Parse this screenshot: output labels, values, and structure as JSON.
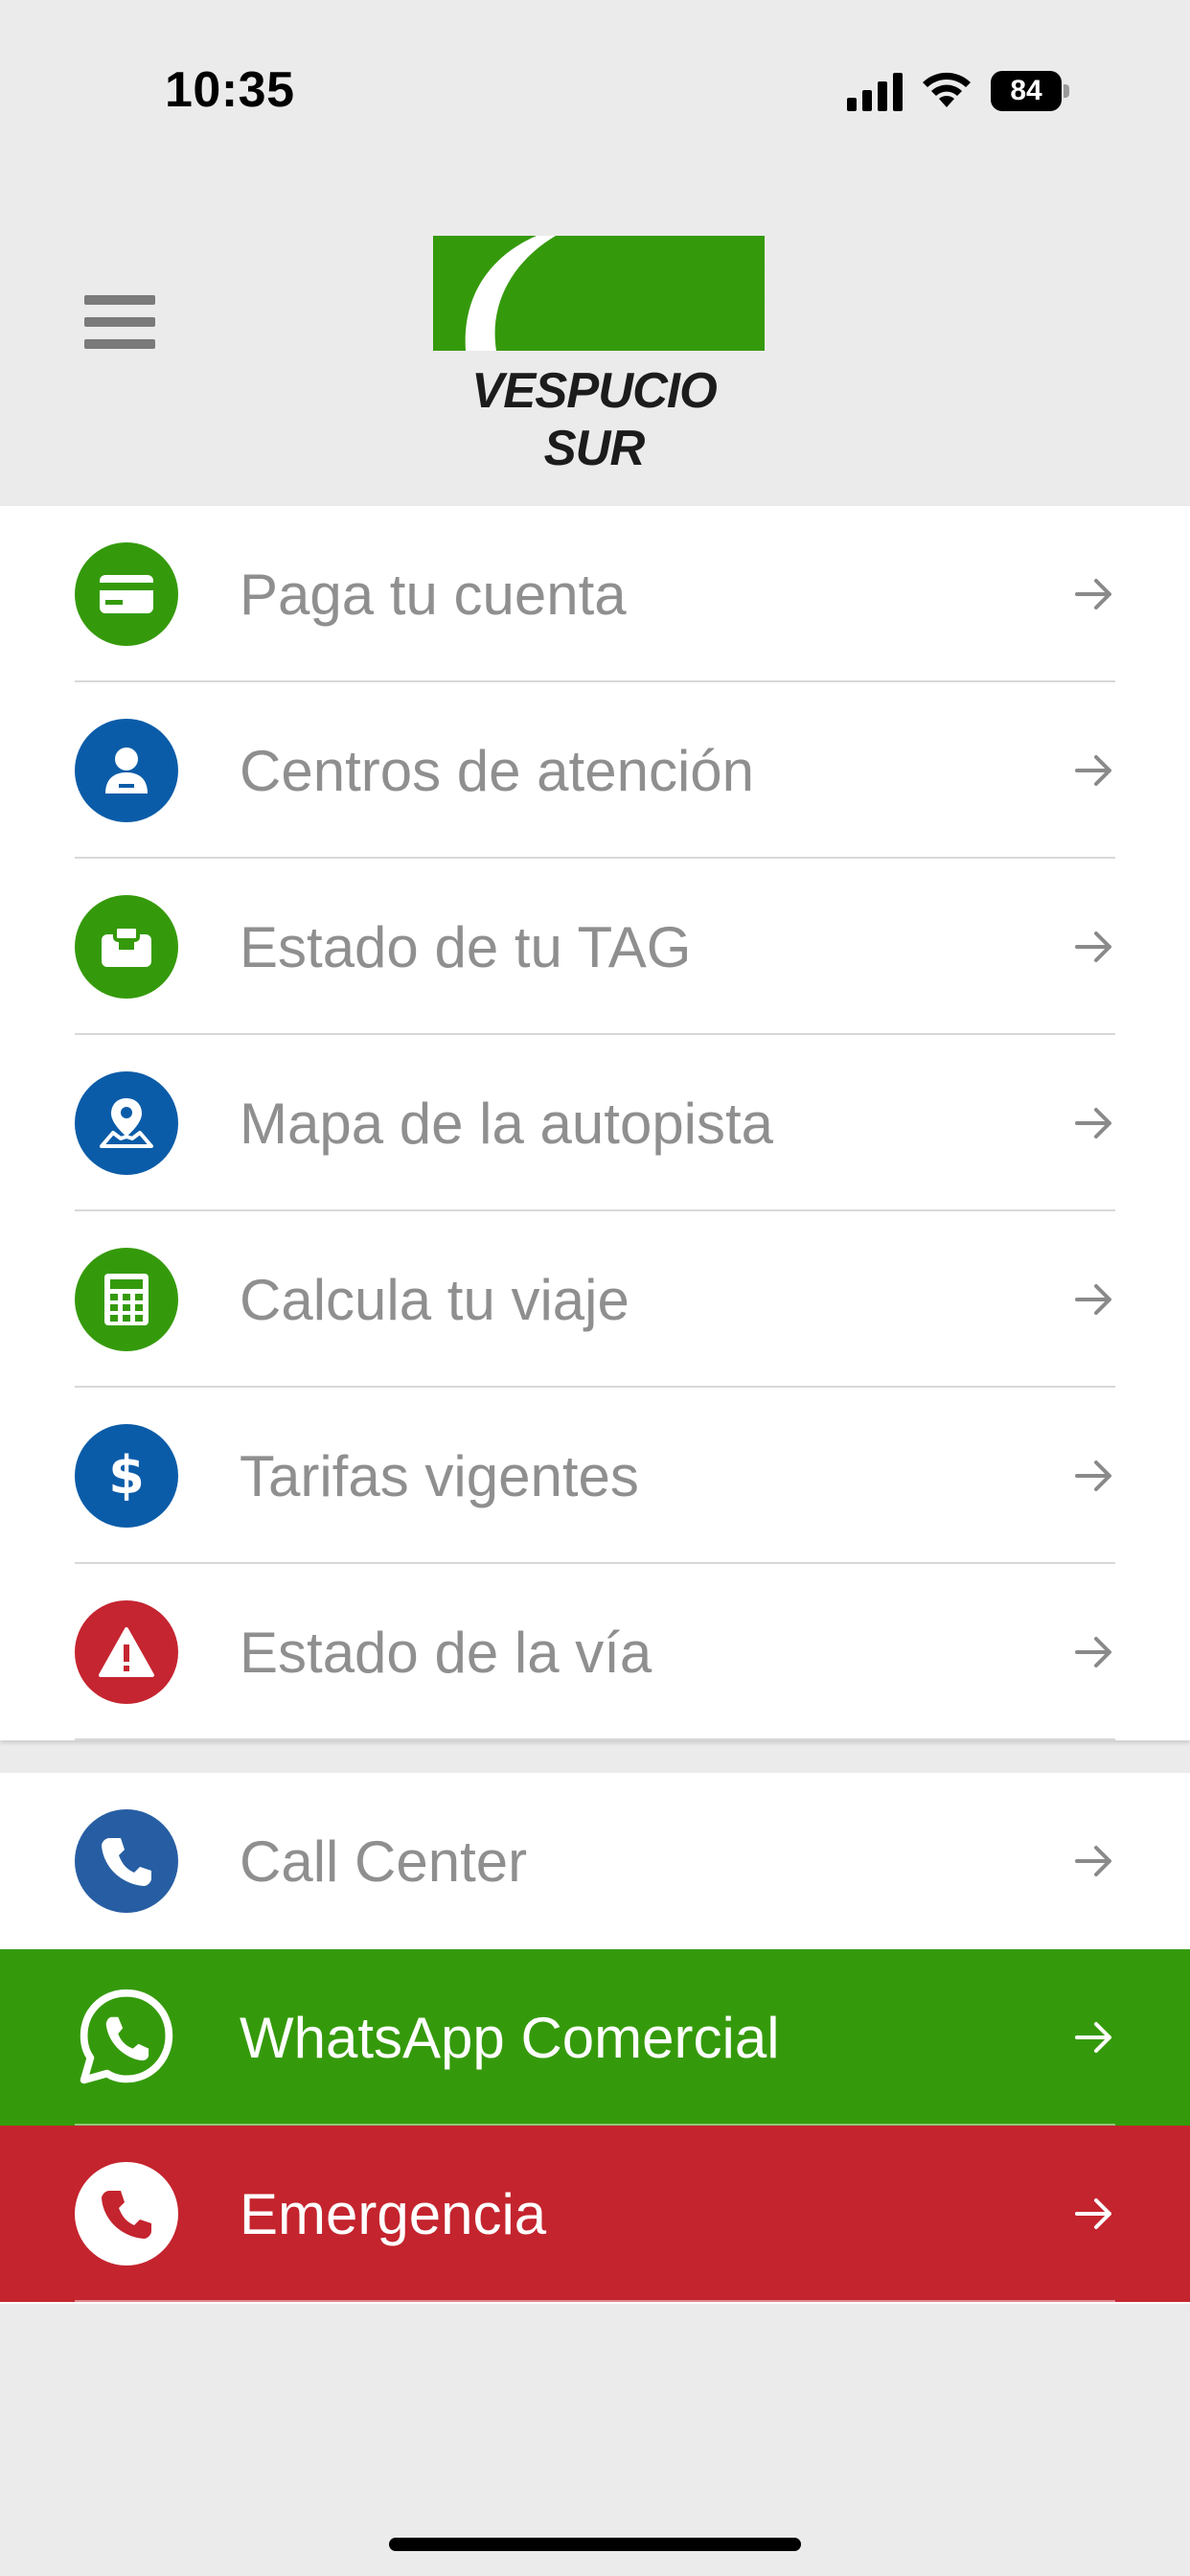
{
  "status_bar": {
    "time": "10:35",
    "battery": "84"
  },
  "header": {
    "logo_text": "VESPUCIO SUR",
    "brand_color": "#359a0b"
  },
  "menu": [
    {
      "label": "Paga tu cuenta",
      "icon": "credit-card-icon",
      "color": "#359a0b"
    },
    {
      "label": "Centros de atención",
      "icon": "agent-icon",
      "color": "#0b5ca8"
    },
    {
      "label": "Estado de tu TAG",
      "icon": "tag-device-icon",
      "color": "#359a0b"
    },
    {
      "label": "Mapa de la autopista",
      "icon": "map-pin-icon",
      "color": "#0b5ca8"
    },
    {
      "label": "Calcula tu viaje",
      "icon": "calculator-icon",
      "color": "#359a0b"
    },
    {
      "label": "Tarifas vigentes",
      "icon": "dollar-icon",
      "color": "#0b5ca8"
    },
    {
      "label": "Estado de la vía",
      "icon": "warning-icon",
      "color": "#c52530"
    }
  ],
  "contact": [
    {
      "label": "Call Center",
      "icon": "phone-icon",
      "color": "#275ea3"
    },
    {
      "label": "WhatsApp Comercial",
      "icon": "whatsapp-icon",
      "color": "#359a0b"
    },
    {
      "label": "Emergencia",
      "icon": "phone-icon",
      "color": "#c4242e"
    }
  ]
}
